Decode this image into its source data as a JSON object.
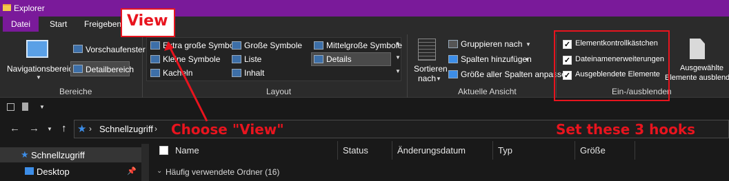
{
  "window": {
    "title": "Explorer"
  },
  "tabs": [
    "Datei",
    "Start",
    "Freigeben"
  ],
  "ribbon": {
    "bereiche": {
      "nav_pane_label": "Navigationsbereich",
      "preview_label": "Vorschaufenster",
      "details_pane_label": "Detailbereich",
      "group": "Bereiche"
    },
    "layout": {
      "items": [
        "Extra große Symbole",
        "Große Symbole",
        "Mittelgroße Symbole",
        "Kleine Symbole",
        "Liste",
        "Details",
        "Kacheln",
        "Inhalt"
      ],
      "group": "Layout"
    },
    "current_view": {
      "sort_line1": "Sortieren",
      "sort_line2": "nach",
      "group_by": "Gruppieren nach",
      "add_columns": "Spalten hinzufügen",
      "fit_columns": "Größe aller Spalten anpassen",
      "group": "Aktuelle Ansicht"
    },
    "show_hide": {
      "item_checkboxes": "Elementkontrollkästchen",
      "file_extensions": "Dateinamenerweiterungen",
      "hidden_items": "Ausgeblendete Elemente",
      "group": "Ein-/ausblenden",
      "hide_selected_line1": "Ausgewählte",
      "hide_selected_line2": "Elemente ausblende"
    }
  },
  "address": {
    "path": "Schnellzugriff",
    "separator": "›"
  },
  "nav_pane": {
    "items": [
      "Schnellzugriff",
      "Desktop"
    ]
  },
  "columns": [
    "Name",
    "Status",
    "Änderungsdatum",
    "Typ",
    "Größe"
  ],
  "group_header": "Häufig verwendete Ordner (16)",
  "annotations": {
    "view_label": "View",
    "choose_view": "Choose \"View\"",
    "set_hooks": "Set these 3 hooks"
  },
  "colors": {
    "titlebar": "#7a1a9a",
    "annotation": "#e8141e",
    "accent_blue": "#3d8ee8"
  }
}
